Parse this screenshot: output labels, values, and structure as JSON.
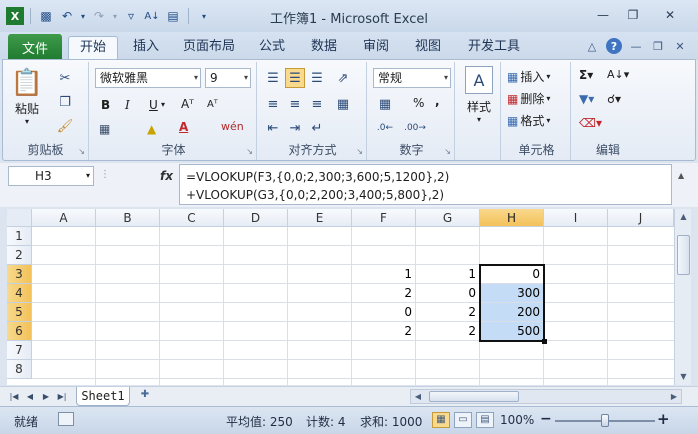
{
  "window": {
    "title": "工作簿1 - Microsoft Excel"
  },
  "ribbon_tabs": {
    "file": "文件",
    "tabs": [
      "开始",
      "插入",
      "页面布局",
      "公式",
      "数据",
      "审阅",
      "视图",
      "开发工具"
    ],
    "active": "开始"
  },
  "ribbon": {
    "clipboard": {
      "paste": "粘贴",
      "label": "剪贴板"
    },
    "font": {
      "name": "微软雅黑",
      "size": "9",
      "bold": "B",
      "italic": "I",
      "underline": "U",
      "font_a": "A",
      "wen": "wén",
      "label": "字体"
    },
    "alignment": {
      "label": "对齐方式"
    },
    "number": {
      "format": "常规",
      "percent": "%",
      "comma": ",",
      "label": "数字"
    },
    "styles": {
      "label": "样式"
    },
    "cells": {
      "insert": "插入",
      "delete": "删除",
      "format": "格式",
      "label": "单元格"
    },
    "editing": {
      "label": "编辑"
    }
  },
  "formula_bar": {
    "name_box": "H3",
    "fx": "fx",
    "line1": "=VLOOKUP(F3,{0,0;2,300;3,600;5,1200},2)",
    "line2": "+VLOOKUP(G3,{0,0;2,200;3,400;5,800},2)"
  },
  "sheet": {
    "columns": [
      "A",
      "B",
      "C",
      "D",
      "E",
      "F",
      "G",
      "H",
      "I",
      "J"
    ],
    "selected_column": "H",
    "rows": [
      "1",
      "2",
      "3",
      "4",
      "5",
      "6",
      "7",
      "8"
    ],
    "selected_rows": [
      "3",
      "4",
      "5",
      "6"
    ],
    "cells": {
      "F3": "1",
      "G3": "1",
      "H3": "0",
      "F4": "2",
      "G4": "0",
      "H4": "300",
      "F5": "0",
      "G5": "2",
      "H5": "200",
      "F6": "2",
      "G6": "2",
      "H6": "500"
    }
  },
  "sheet_tabs": {
    "active": "Sheet1"
  },
  "status_bar": {
    "ready": "就绪",
    "average": "平均值: 250",
    "count": "计数: 4",
    "sum": "求和: 1000",
    "zoom": "100%",
    "minus": "−",
    "plus": "+"
  },
  "colors": {
    "file_tab": "#1f7b2f",
    "selection_fill": "#c5dcf6",
    "header_highlight": "#f3c15a"
  }
}
